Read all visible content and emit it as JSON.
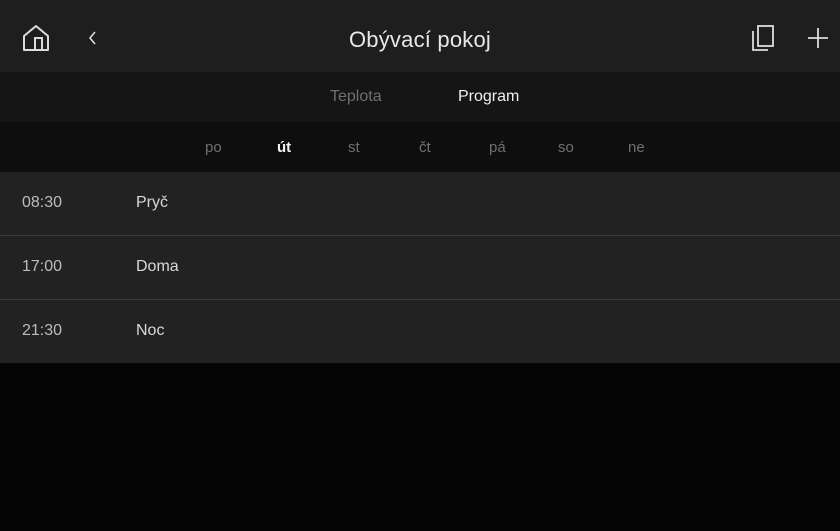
{
  "header": {
    "title": "Obývací pokoj",
    "home_icon": "home-icon",
    "back_icon": "chevron-left-icon",
    "copy_icon": "copy-icon",
    "add_icon": "plus-icon"
  },
  "tabs": [
    {
      "label": "Teplota",
      "active": false
    },
    {
      "label": "Program",
      "active": true
    }
  ],
  "days": [
    {
      "label": "po",
      "active": false
    },
    {
      "label": "út",
      "active": true
    },
    {
      "label": "st",
      "active": false
    },
    {
      "label": "čt",
      "active": false
    },
    {
      "label": "pá",
      "active": false
    },
    {
      "label": "so",
      "active": false
    },
    {
      "label": "ne",
      "active": false
    }
  ],
  "schedule": [
    {
      "time": "08:30",
      "mode": "Pryč"
    },
    {
      "time": "17:00",
      "mode": "Doma"
    },
    {
      "time": "21:30",
      "mode": "Noc"
    }
  ],
  "colors": {
    "background": "#050505",
    "header": "#1e1e1e",
    "row": "#222222",
    "active_text": "#f0f0f0",
    "inactive_text": "#707070"
  }
}
